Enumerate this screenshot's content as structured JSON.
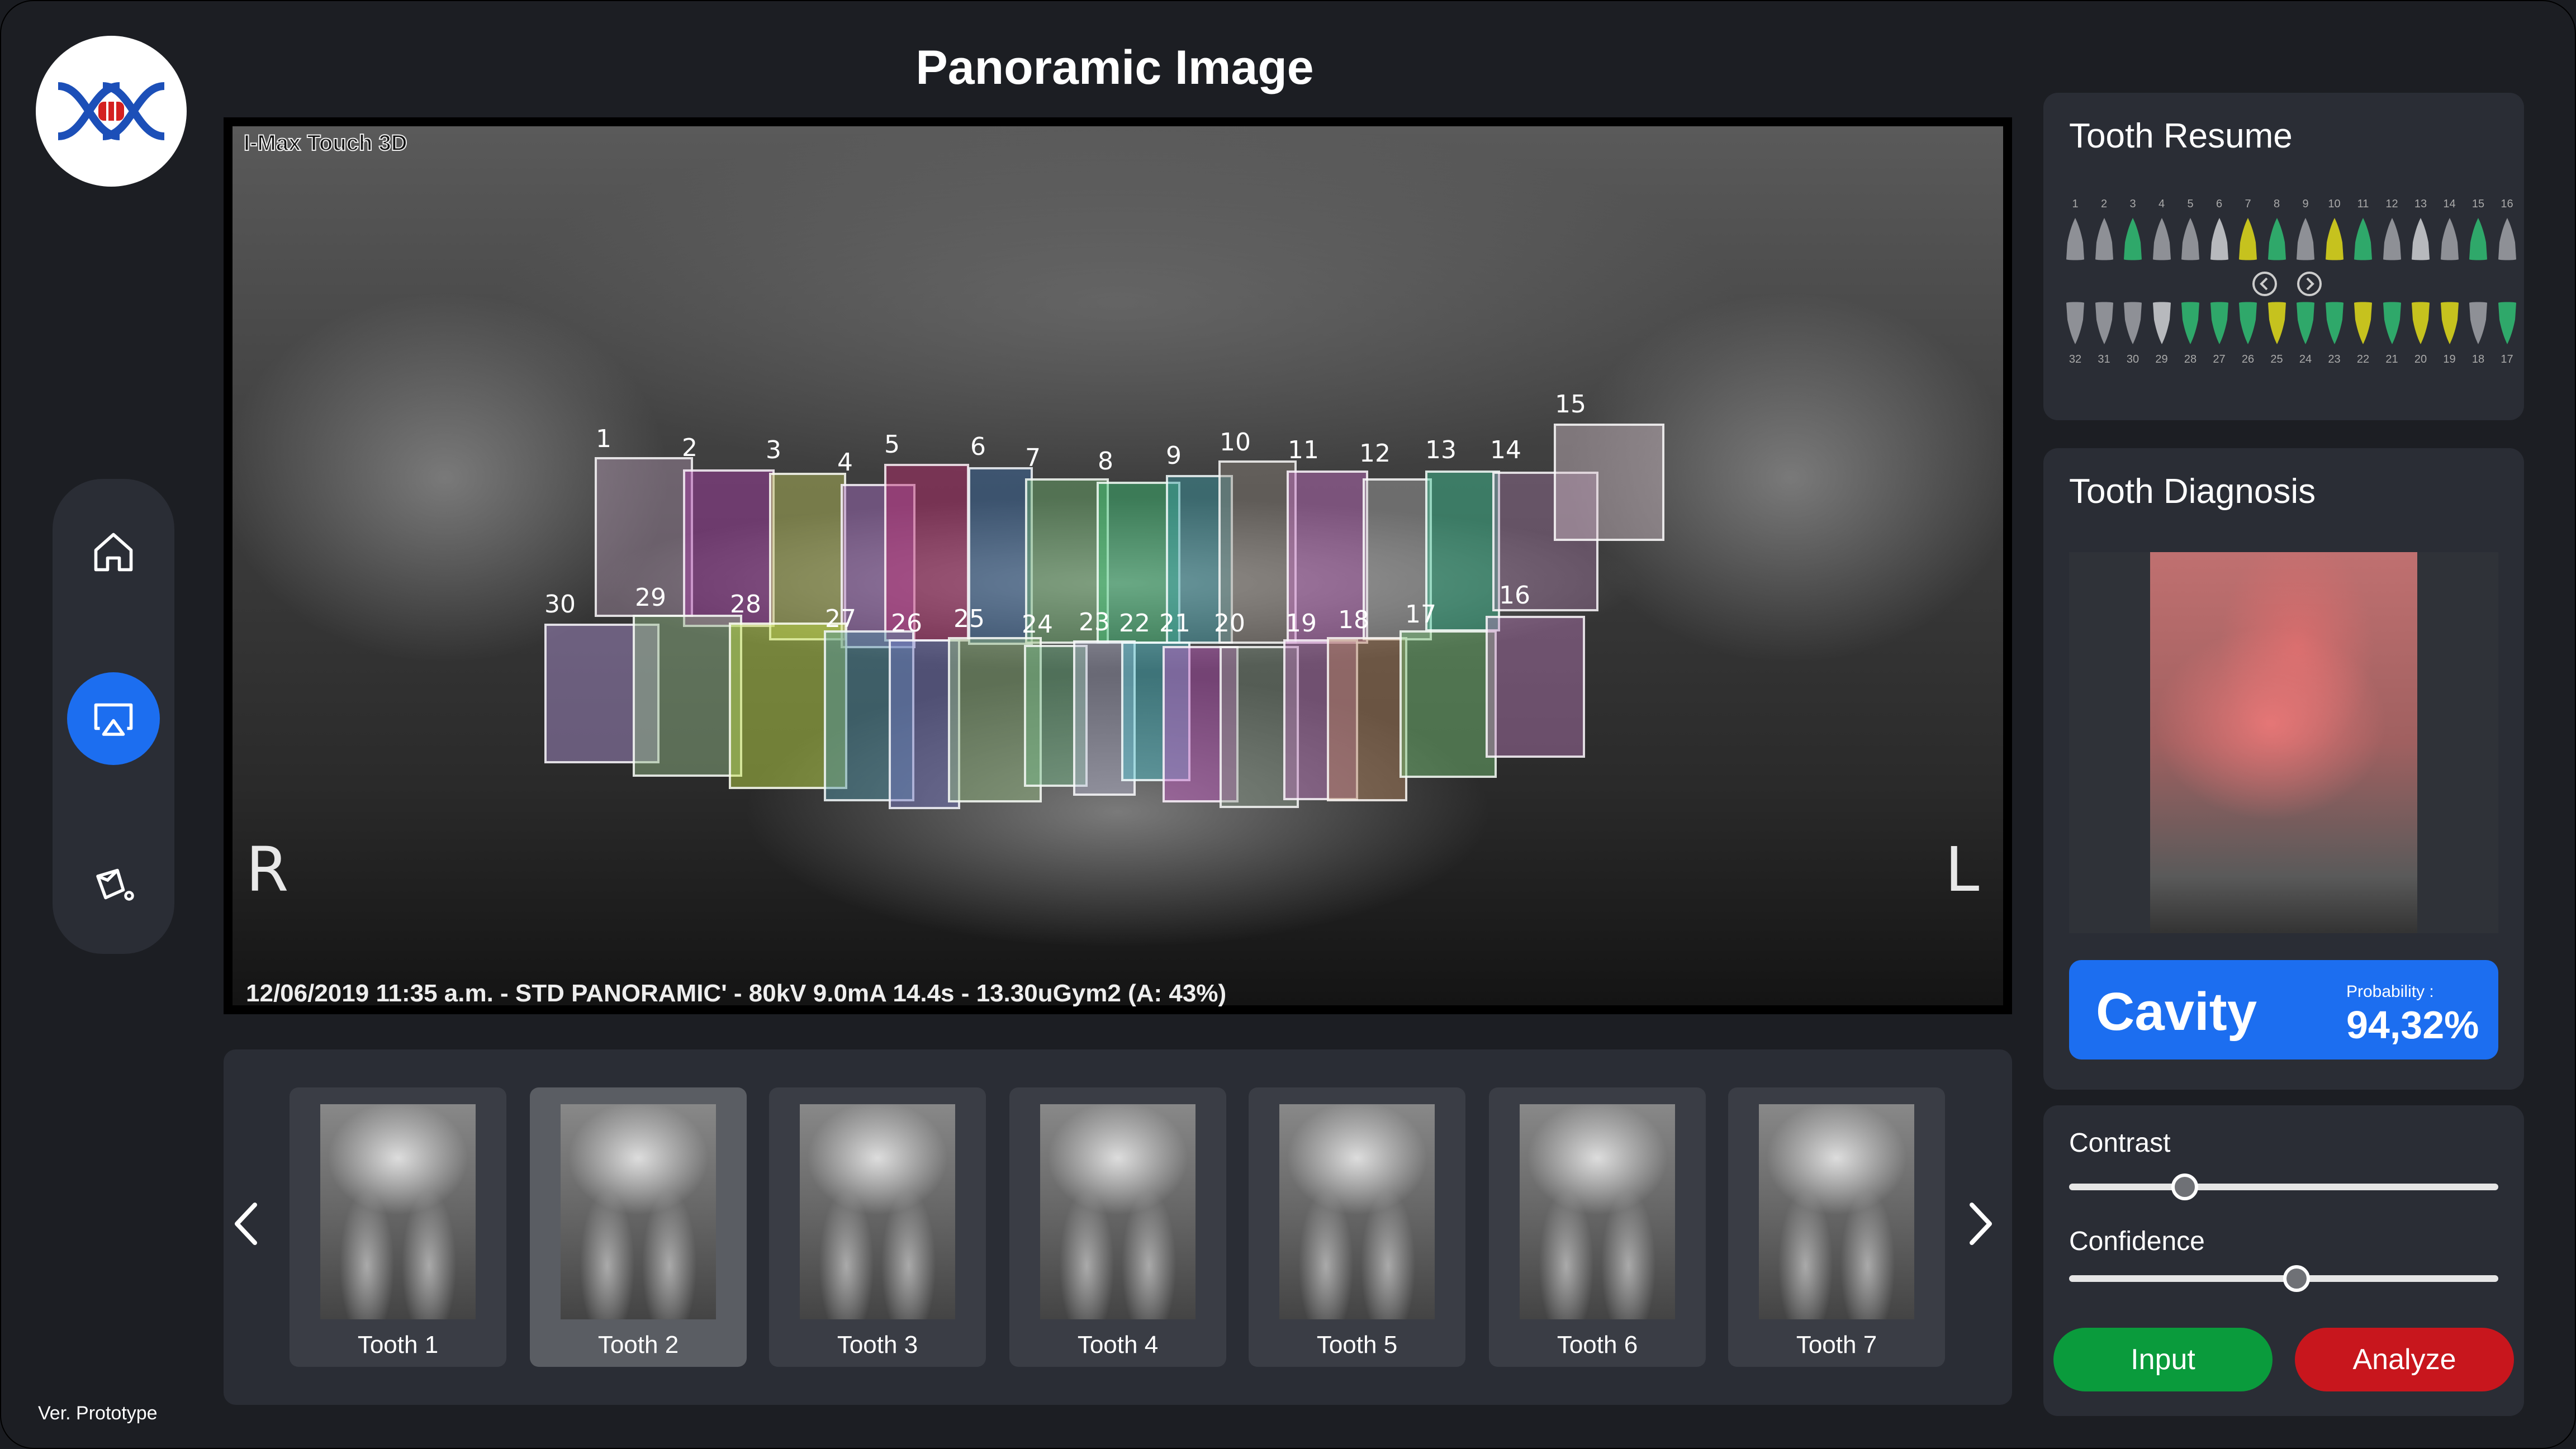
{
  "app": {
    "page_title": "Panoramic Image",
    "version_label": "Ver.  Prototype",
    "accent_color": "#1c6ef0"
  },
  "nav": {
    "items": [
      {
        "icon": "home-icon",
        "active": false
      },
      {
        "icon": "screen-share-icon",
        "active": true
      },
      {
        "icon": "paint-bucket-icon",
        "active": false
      }
    ]
  },
  "xray": {
    "brand": "I-Max Touch 3D",
    "side_right": "R",
    "side_left": "L",
    "meta": "12/06/2019 11:35 a.m. - STD PANORAMIC' - 80kV 9.0mA 14.4s - 13.30uGym2   (A: 43%)",
    "tooth_numbers": [
      "1",
      "2",
      "3",
      "4",
      "5",
      "6",
      "7",
      "8",
      "9",
      "10",
      "11",
      "12",
      "13",
      "14",
      "15",
      "16",
      "17",
      "18",
      "19",
      "20",
      "21",
      "22",
      "23",
      "24",
      "25",
      "26",
      "27",
      "28",
      "29",
      "30"
    ]
  },
  "thumbnails": {
    "selected_index": 1,
    "items": [
      {
        "label": "Tooth 1"
      },
      {
        "label": "Tooth 2"
      },
      {
        "label": "Tooth 3"
      },
      {
        "label": "Tooth 4"
      },
      {
        "label": "Tooth 5"
      },
      {
        "label": "Tooth 6"
      },
      {
        "label": "Tooth 7"
      }
    ]
  },
  "tooth_resume": {
    "title": "Tooth Resume",
    "upper_numbers": [
      "1",
      "2",
      "3",
      "4",
      "5",
      "6",
      "7",
      "8",
      "9",
      "10",
      "11",
      "12",
      "13",
      "14",
      "15",
      "16"
    ],
    "lower_numbers": [
      "32",
      "31",
      "30",
      "29",
      "28",
      "27",
      "26",
      "25",
      "24",
      "23",
      "22",
      "21",
      "20",
      "19",
      "18",
      "17"
    ]
  },
  "tooth_diagnosis": {
    "title": "Tooth Diagnosis",
    "result": "Cavity",
    "probability_label": "Probability :",
    "probability_value": "94,32%"
  },
  "controls": {
    "contrast_label": "Contrast",
    "contrast_value": 0.27,
    "confidence_label": "Confidence",
    "confidence_value": 0.53,
    "input_label": "Input",
    "analyze_label": "Analyze",
    "input_color": "#0a9b3c",
    "analyze_color": "#c8161d"
  }
}
